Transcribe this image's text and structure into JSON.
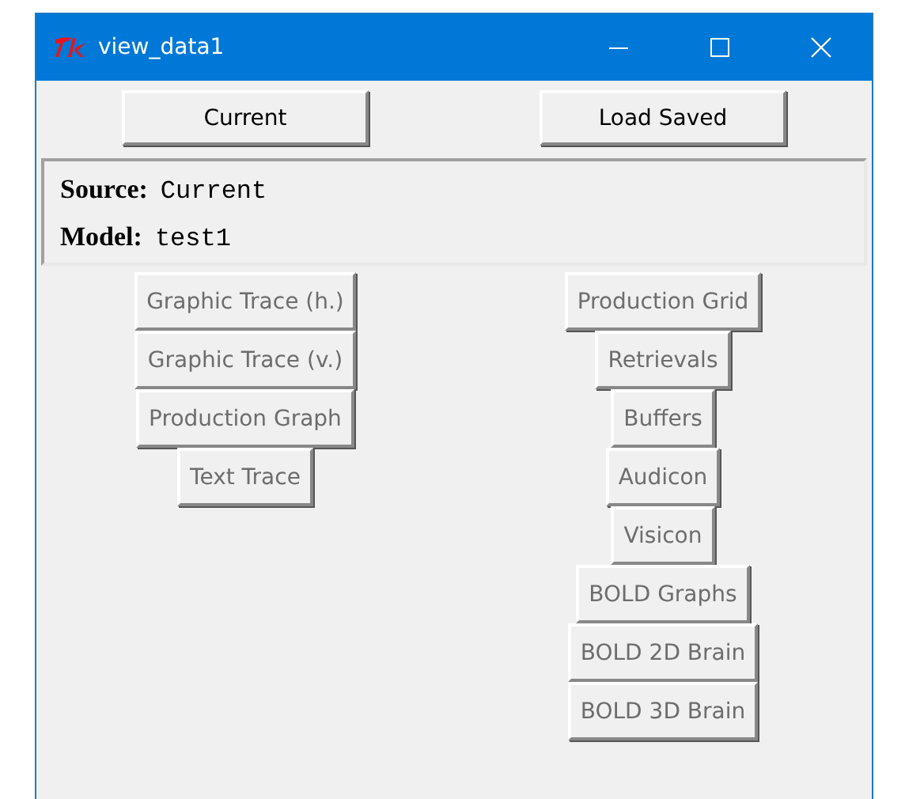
{
  "window": {
    "title": "view_data1"
  },
  "top_buttons": [
    {
      "label": "Current"
    },
    {
      "label": "Load Saved"
    }
  ],
  "info": [
    {
      "label": "Source:",
      "value": "Current"
    },
    {
      "label": "Model:",
      "value": "test1"
    }
  ],
  "left_buttons": [
    {
      "label": "Graphic Trace (h.)",
      "disabled": true
    },
    {
      "label": "Graphic Trace (v.)",
      "disabled": true
    },
    {
      "label": "Production Graph",
      "disabled": true
    },
    {
      "label": "Text Trace",
      "disabled": true
    }
  ],
  "right_buttons": [
    {
      "label": "Production Grid",
      "disabled": true
    },
    {
      "label": "Retrievals",
      "disabled": true
    },
    {
      "label": "Buffers",
      "disabled": true
    },
    {
      "label": "Audicon",
      "disabled": true
    },
    {
      "label": "Visicon",
      "disabled": true
    },
    {
      "label": "BOLD Graphs",
      "disabled": true
    },
    {
      "label": "BOLD 2D Brain",
      "disabled": true
    },
    {
      "label": "BOLD 3D Brain",
      "disabled": true
    }
  ]
}
